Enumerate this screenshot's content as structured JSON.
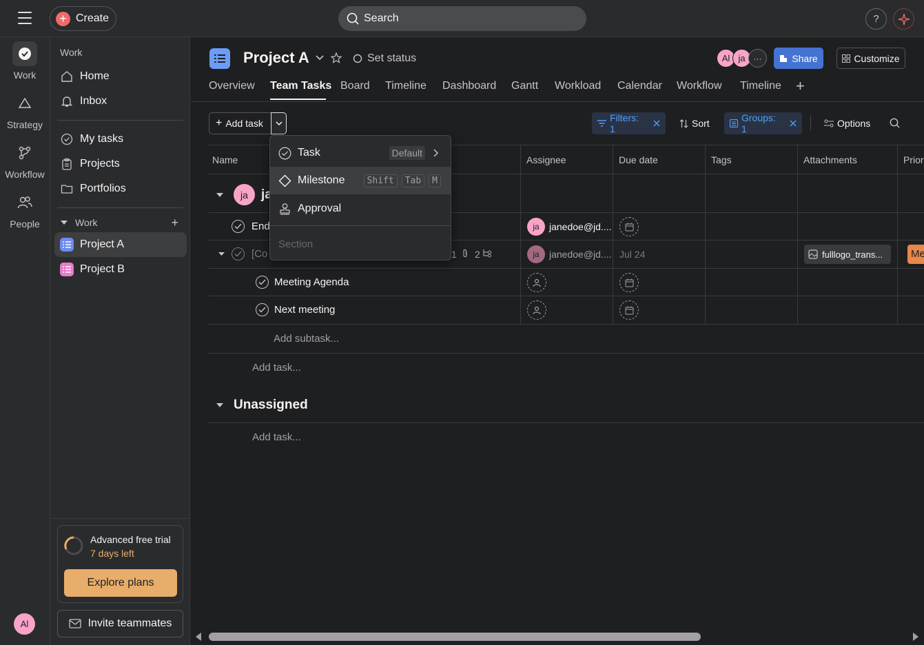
{
  "topbar": {
    "create_label": "Create",
    "search_placeholder": "Search",
    "help_label": "?"
  },
  "rail": {
    "items": [
      {
        "label": "Work"
      },
      {
        "label": "Strategy"
      },
      {
        "label": "Workflow"
      },
      {
        "label": "People"
      }
    ],
    "user_initials": "Al"
  },
  "sidebar": {
    "section_title": "Work",
    "home": "Home",
    "inbox": "Inbox",
    "my_tasks": "My tasks",
    "projects": "Projects",
    "portfolios": "Portfolios",
    "work_group": "Work",
    "project_a": "Project A",
    "project_b": "Project B",
    "trial_title": "Advanced free trial",
    "trial_days": "7 days left",
    "explore_label": "Explore plans",
    "invite_label": "Invite teammates"
  },
  "project": {
    "title": "Project A",
    "set_status": "Set status",
    "avatar1": "Al",
    "avatar2": "ja",
    "share_label": "Share",
    "customize_label": "Customize"
  },
  "tabs": [
    "Overview",
    "Team Tasks",
    "Board",
    "Timeline",
    "Dashboard",
    "Gantt",
    "Workload",
    "Calendar",
    "Workflow",
    "Timeline"
  ],
  "toolbar": {
    "add_task": "Add task",
    "filters": "Filters: 1",
    "sort": "Sort",
    "groups": "Groups: 1",
    "options": "Options"
  },
  "columns": [
    "Name",
    "Assignee",
    "Due date",
    "Tags",
    "Attachments",
    "Prior"
  ],
  "group1": {
    "avatar": "ja",
    "label": "ja"
  },
  "rows": [
    {
      "name": "End",
      "assignee_initials": "ja",
      "assignee": "janedoe@jd....",
      "due": ""
    },
    {
      "name": "[Co",
      "meta1": "1",
      "meta2": "2",
      "assignee_initials": "ja",
      "assignee": "janedoe@jd....",
      "due": "Jul 24",
      "attachment": "fulllogo_trans...",
      "priority": "Me"
    },
    {
      "name": "Meeting Agenda"
    },
    {
      "name": "Next meeting"
    }
  ],
  "add_subtask": "Add subtask...",
  "add_task_row": "Add task...",
  "group2": {
    "label": "Unassigned",
    "add_task": "Add task..."
  },
  "dropdown": {
    "task": "Task",
    "task_badge": "Default",
    "milestone": "Milestone",
    "keys": [
      "Shift",
      "Tab",
      "M"
    ],
    "approval": "Approval",
    "section": "Section"
  },
  "colors": {
    "accent_blue": "#4573d2",
    "create_red": "#f06a6a",
    "explore_orange": "#e8ad6b",
    "avatar_pink": "#f8a4c7"
  }
}
